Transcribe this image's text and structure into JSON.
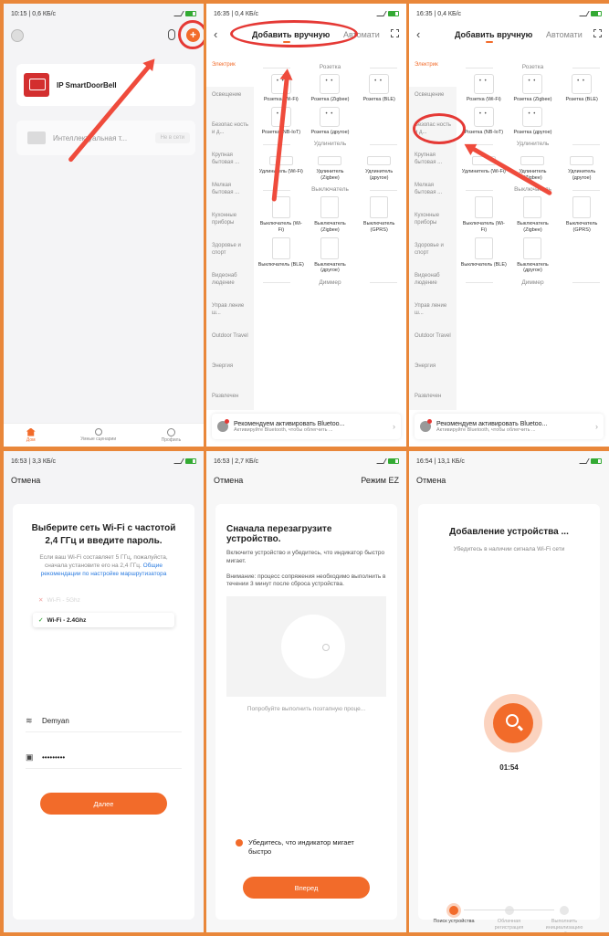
{
  "p1": {
    "status": "10:15 | 0,6 КБ/с",
    "plus": "+",
    "devices": [
      {
        "name": "IP SmartDoorBell"
      },
      {
        "name": "Интеллектуальная т...",
        "status": "Не в сети"
      }
    ],
    "nav": [
      "Дом",
      "Умные сценарии",
      "Профиль"
    ]
  },
  "p2": {
    "status": "16:35 | 0,4 КБ/с",
    "tab_manual": "Добавить вручную",
    "tab_auto": "Автомати",
    "categories": [
      "Электрик",
      "Освещение",
      "Безопас ность и д...",
      "Крупная бытовая ...",
      "Мелкая бытовая ...",
      "Кухонные приборы",
      "Здоровье и спорт",
      "Видеонаб людение",
      "Управ ление ш...",
      "Outdoor Travel",
      "Энергия",
      "Развлечен"
    ],
    "sections": {
      "socket": "Розетка",
      "extender": "Удлинитель",
      "switch": "Выключатель",
      "dimmer": "Диммер"
    },
    "sockets": [
      "Розетка (Wi-Fi)",
      "Розетка (Zigbee)",
      "Розетка (BLE)",
      "Розетка (NB-IoT)",
      "Розетка (другое)"
    ],
    "extenders": [
      "Удлинитель (Wi-Fi)",
      "Удлинитель (Zigbee)",
      "Удлинитель (другое)"
    ],
    "switches": [
      "Выключатель (Wi-Fi)",
      "Выключатель (Zigbee)",
      "Выключатель (GPRS)",
      "Выключатель (BLE)",
      "Выключатель (другое)"
    ],
    "reco_title": "Рекомендуем активировать Bluetoo...",
    "reco_sub": "Активируйте Bluetooth, чтобы облегчить ..."
  },
  "p3": {
    "status": "16:35 | 0,4 КБ/с"
  },
  "p4": {
    "status": "16:53 | 3,3 КБ/с",
    "cancel": "Отмена",
    "title": "Выберите сеть Wi-Fi с частотой 2,4 ГГц и введите пароль.",
    "sub": "Если ваш Wi-Fi составляет 5 ГГц, пожалуйста, сначала установите его на 2,4 ГГц.",
    "link": "Общие рекомендации по настройке маршрутизатора",
    "wifi_bad": "Wi-Fi - 5Ghz",
    "wifi_good": "Wi-Fi - 2.4Ghz",
    "ssid": "Demyan",
    "password": "•••••••••",
    "next": "Далее"
  },
  "p5": {
    "status": "16:53 | 2,7 КБ/с",
    "cancel": "Отмена",
    "mode": "Режим EZ",
    "title": "Сначала перезагрузите устройство.",
    "text1": "Включите устройство и убедитесь, что индикатор быстро мигает.",
    "text2": "Внимание: процесс сопряжения необходимо выполнить в течении 3 минут после сброса устройства.",
    "try": "Попробуйте выполнить поэтапную проце...",
    "confirm": "Убедитесь, что индикатор мигает быстро",
    "next": "Вперед"
  },
  "p6": {
    "status": "16:54 | 13,1 КБ/с",
    "cancel": "Отмена",
    "title": "Добавление устройства ...",
    "sub": "Убедитесь в наличии сигнала Wi-Fi сети",
    "timer": "01:54",
    "steps": [
      "Поиск устройства",
      "Облачная регистрация",
      "Выполнить инициализацию устройства"
    ]
  },
  "colors": {
    "accent": "#f26b2a",
    "annotation": "#e53935",
    "frame": "#e9873a"
  }
}
